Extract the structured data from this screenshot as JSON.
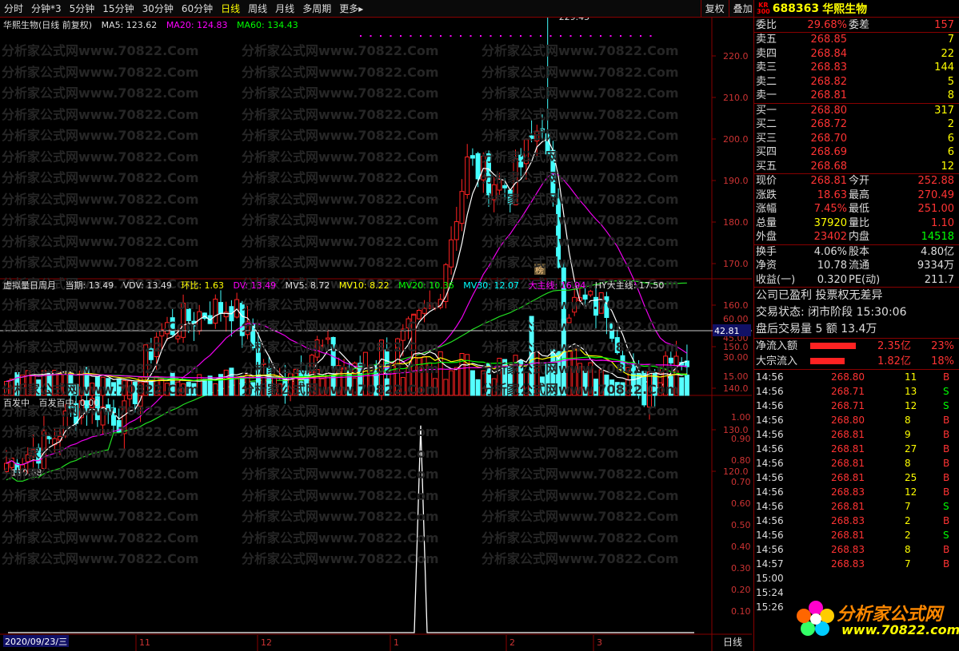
{
  "toolbar": {
    "periods": [
      "分时",
      "分钟*3",
      "5分钟",
      "15分钟",
      "30分钟",
      "60分钟",
      "日线",
      "周线",
      "月线",
      "多周期",
      "更多▸"
    ],
    "active": 6,
    "tools": [
      "复权",
      "叠加",
      "历史",
      "统计",
      "画线",
      "F10",
      "标记",
      "+自选",
      "返回"
    ]
  },
  "main_chart": {
    "title": "华熙生物(日线 前复权)",
    "ma5": "MA5: 123.62",
    "ma20": "MA20: 124.83",
    "ma60": "MA60: 134.43",
    "high_label": "229.45",
    "low_label": "119.68",
    "bang": "榜",
    "y_ticks": [
      220,
      210,
      200,
      190,
      180,
      170,
      160,
      150,
      140,
      130,
      120
    ]
  },
  "vol_chart": {
    "title": "虚拟量日周月",
    "current": "当期: 13.49",
    "vdv": "VDV: 13.49",
    "hb": "环比: 1.63",
    "dv": "DV: 13.49",
    "mv5": "MV5: 8.72",
    "mv10": "MV10: 8.22",
    "mv20": "MV20: 10.36",
    "mv30": "MV30: 12.07",
    "dzx": "大主线: 16.94",
    "hy": "HY大主线: 17.50",
    "y_ticks": [
      "60.00",
      "45.00",
      "30.00",
      "15.00"
    ],
    "cursor": "42.81"
  },
  "ind_chart": {
    "title": "百发中",
    "value": "百发百中: 0.00",
    "y_ticks": [
      "1.00",
      "0.90",
      "0.80",
      "0.70",
      "0.60",
      "0.50",
      "0.40",
      "0.30",
      "0.20",
      "0.10"
    ]
  },
  "axis": {
    "date": "2020/09/23/三",
    "months": [
      "11",
      "12",
      "1",
      "2",
      "3"
    ],
    "period": "日线"
  },
  "watermark": "分析家公式网www.70822.Com",
  "stock": {
    "kr": "KR",
    "sub": "300",
    "code": "688363",
    "name": "华熙生物"
  },
  "weibi": {
    "label": "委比",
    "value": "29.68%",
    "label2": "委差",
    "value2": "157"
  },
  "asks": [
    {
      "l": "卖五",
      "p": "268.85",
      "v": "7"
    },
    {
      "l": "卖四",
      "p": "268.84",
      "v": "22"
    },
    {
      "l": "卖三",
      "p": "268.83",
      "v": "144"
    },
    {
      "l": "卖二",
      "p": "268.82",
      "v": "5"
    },
    {
      "l": "卖一",
      "p": "268.81",
      "v": "8"
    }
  ],
  "bids": [
    {
      "l": "买一",
      "p": "268.80",
      "v": "317"
    },
    {
      "l": "买二",
      "p": "268.72",
      "v": "2"
    },
    {
      "l": "买三",
      "p": "268.70",
      "v": "6"
    },
    {
      "l": "买四",
      "p": "268.69",
      "v": "6"
    },
    {
      "l": "买五",
      "p": "268.68",
      "v": "12"
    }
  ],
  "quote": [
    {
      "a": "现价",
      "b": "268.81",
      "c": "今开",
      "d": "252.88",
      "bc": "#f33",
      "dc": "#f33"
    },
    {
      "a": "涨跌",
      "b": "18.63",
      "c": "最高",
      "d": "270.49",
      "bc": "#f33",
      "dc": "#f33"
    },
    {
      "a": "涨幅",
      "b": "7.45%",
      "c": "最低",
      "d": "251.00",
      "bc": "#f33",
      "dc": "#f33"
    },
    {
      "a": "总量",
      "b": "37920",
      "c": "量比",
      "d": "1.10",
      "bc": "#ff0",
      "dc": "#f33"
    },
    {
      "a": "外盘",
      "b": "23402",
      "c": "内盘",
      "d": "14518",
      "bc": "#f33",
      "dc": "#0f0"
    }
  ],
  "quote2": [
    {
      "a": "换手",
      "b": "4.06%",
      "c": "股本",
      "d": "4.80亿",
      "bc": "#ddd",
      "dc": "#ddd"
    },
    {
      "a": "净资",
      "b": "10.78",
      "c": "流通",
      "d": "9334万",
      "bc": "#ddd",
      "dc": "#ddd"
    },
    {
      "a": "收益(一)",
      "b": "0.320",
      "c": "PE(动)",
      "d": "211.7",
      "bc": "#ddd",
      "dc": "#ddd"
    }
  ],
  "info": [
    "公司已盈利 投票权无差异",
    "交易状态: 闭市阶段 15:30:06",
    "盘后交易量 5 额 13.4万"
  ],
  "flows": [
    {
      "a": "净流入额",
      "n": "2.35亿",
      "pc": "23%",
      "w": 0.95
    },
    {
      "a": "大宗流入",
      "n": "1.82亿",
      "pc": "18%",
      "w": 0.72
    }
  ],
  "ticks": [
    {
      "t": "14:56",
      "p": "268.80",
      "v": "11",
      "s": "B"
    },
    {
      "t": "14:56",
      "p": "268.71",
      "v": "13",
      "s": "S"
    },
    {
      "t": "14:56",
      "p": "268.71",
      "v": "12",
      "s": "S"
    },
    {
      "t": "14:56",
      "p": "268.80",
      "v": "8",
      "s": "B"
    },
    {
      "t": "14:56",
      "p": "268.81",
      "v": "9",
      "s": "B"
    },
    {
      "t": "14:56",
      "p": "268.81",
      "v": "27",
      "s": "B"
    },
    {
      "t": "14:56",
      "p": "268.81",
      "v": "8",
      "s": "B"
    },
    {
      "t": "14:56",
      "p": "268.81",
      "v": "25",
      "s": "B"
    },
    {
      "t": "14:56",
      "p": "268.83",
      "v": "12",
      "s": "B"
    },
    {
      "t": "14:56",
      "p": "268.81",
      "v": "7",
      "s": "S"
    },
    {
      "t": "14:56",
      "p": "268.83",
      "v": "2",
      "s": "B"
    },
    {
      "t": "14:56",
      "p": "268.81",
      "v": "2",
      "s": "S"
    },
    {
      "t": "14:56",
      "p": "268.83",
      "v": "8",
      "s": "B"
    },
    {
      "t": "14:57",
      "p": "268.83",
      "v": "7",
      "s": "B"
    },
    {
      "t": "15:00",
      "p": "",
      "v": "",
      "s": ""
    },
    {
      "t": "15:24",
      "p": "",
      "v": "",
      "s": ""
    },
    {
      "t": "15:26",
      "p": "",
      "v": "",
      "s": ""
    }
  ],
  "logo": {
    "text": "分析家公式网",
    "url": "www.70822.com"
  }
}
